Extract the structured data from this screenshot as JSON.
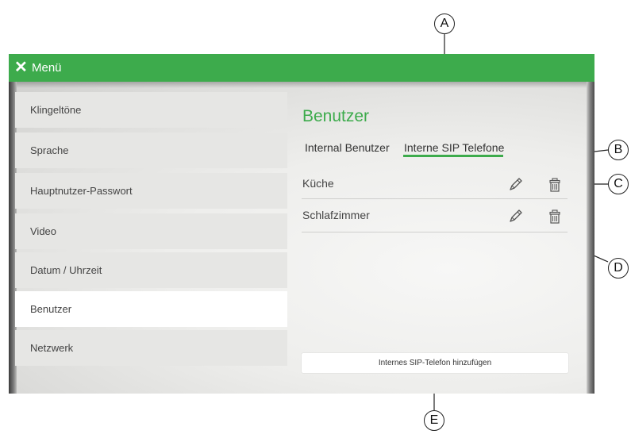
{
  "header": {
    "close_icon": "close-icon",
    "title": "Menü"
  },
  "sidebar": {
    "items": [
      {
        "label": "Klingeltöne",
        "active": false
      },
      {
        "label": "Sprache",
        "active": false
      },
      {
        "label": "Hauptnutzer-Passwort",
        "active": false
      },
      {
        "label": "Video",
        "active": false
      },
      {
        "label": "Datum / Uhrzeit",
        "active": false
      },
      {
        "label": "Benutzer",
        "active": true
      },
      {
        "label": "Netzwerk",
        "active": false
      }
    ]
  },
  "main": {
    "title": "Benutzer",
    "tabs": [
      {
        "label": "Internal Benutzer",
        "active": false
      },
      {
        "label": "Interne SIP Telefone",
        "active": true
      }
    ],
    "rows": [
      {
        "label": "Küche",
        "edit_icon": "pencil-icon",
        "delete_icon": "trash-icon"
      },
      {
        "label": "Schlafzimmer",
        "edit_icon": "pencil-icon",
        "delete_icon": "trash-icon"
      }
    ],
    "add_button_label": "Internes SIP-Telefon hinzufügen"
  },
  "callouts": {
    "a": "A",
    "b": "B",
    "c": "C",
    "d": "D",
    "e": "E"
  },
  "colors": {
    "accent_green": "#3dab4c",
    "menu_item_bg": "#e6e6e4",
    "active_item_bg": "#ffffff"
  }
}
